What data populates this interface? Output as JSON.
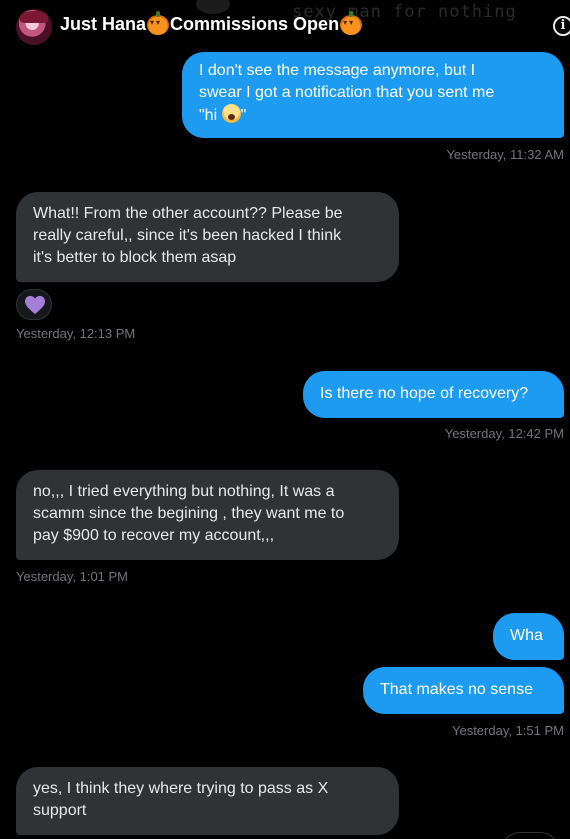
{
  "header": {
    "name": "Just Hana ",
    "suffix": "Commissions Open",
    "background_text": "sexy man for nothing"
  },
  "messages": [
    {
      "id": "m1",
      "side": "sent",
      "lines": [
        "I don't see the message anymore, but I",
        "swear I got a notification that you sent me",
        "\"hi ",
        "\""
      ],
      "emoji": "face-screaming-icon",
      "timestamp": "Yesterday, 11:32 AM"
    },
    {
      "id": "m2",
      "side": "received",
      "lines": [
        "What!! From the other account?? Please be",
        "really careful,, since it's been hacked I think",
        "it's better to block them asap"
      ],
      "reaction": "purple-heart-icon",
      "timestamp": "Yesterday, 12:13 PM"
    },
    {
      "id": "m3",
      "side": "sent",
      "lines": [
        "Is there no hope of recovery?"
      ],
      "timestamp": "Yesterday, 12:42 PM"
    },
    {
      "id": "m4",
      "side": "received",
      "lines": [
        "no,,, I tried everything but nothing, It was a",
        "scamm since the begining , they want me to",
        "pay $900 to recover my account,,,"
      ],
      "timestamp": "Yesterday, 1:01 PM"
    },
    {
      "id": "m5",
      "side": "sent",
      "lines": [
        "Wha"
      ]
    },
    {
      "id": "m6",
      "side": "sent",
      "lines": [
        "That makes no sense"
      ],
      "timestamp": "Yesterday, 1:51 PM"
    },
    {
      "id": "m7",
      "side": "received",
      "lines": [
        "yes, I think they where trying to pass as X",
        "support"
      ]
    }
  ],
  "colors": {
    "sent": "#1d9bf0",
    "received": "#2f3336",
    "timestamp": "#71767b",
    "heart": "#a47fd8"
  }
}
